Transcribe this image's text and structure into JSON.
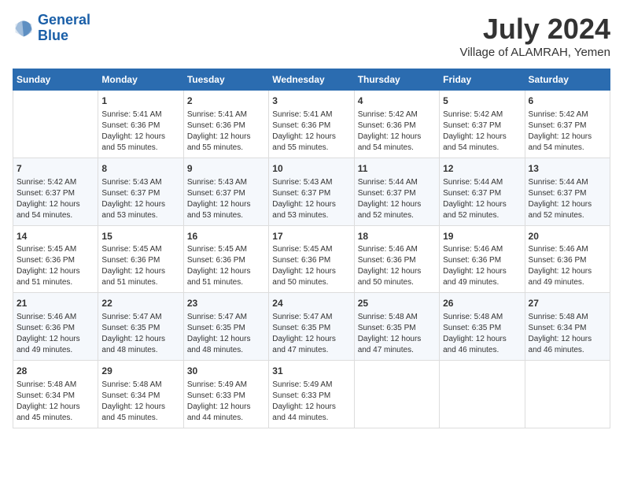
{
  "header": {
    "logo_line1": "General",
    "logo_line2": "Blue",
    "month_year": "July 2024",
    "location": "Village of ALAMRAH, Yemen"
  },
  "weekdays": [
    "Sunday",
    "Monday",
    "Tuesday",
    "Wednesday",
    "Thursday",
    "Friday",
    "Saturday"
  ],
  "weeks": [
    [
      {
        "day": "",
        "content": ""
      },
      {
        "day": "1",
        "content": "Sunrise: 5:41 AM\nSunset: 6:36 PM\nDaylight: 12 hours\nand 55 minutes."
      },
      {
        "day": "2",
        "content": "Sunrise: 5:41 AM\nSunset: 6:36 PM\nDaylight: 12 hours\nand 55 minutes."
      },
      {
        "day": "3",
        "content": "Sunrise: 5:41 AM\nSunset: 6:36 PM\nDaylight: 12 hours\nand 55 minutes."
      },
      {
        "day": "4",
        "content": "Sunrise: 5:42 AM\nSunset: 6:36 PM\nDaylight: 12 hours\nand 54 minutes."
      },
      {
        "day": "5",
        "content": "Sunrise: 5:42 AM\nSunset: 6:37 PM\nDaylight: 12 hours\nand 54 minutes."
      },
      {
        "day": "6",
        "content": "Sunrise: 5:42 AM\nSunset: 6:37 PM\nDaylight: 12 hours\nand 54 minutes."
      }
    ],
    [
      {
        "day": "7",
        "content": "Sunrise: 5:42 AM\nSunset: 6:37 PM\nDaylight: 12 hours\nand 54 minutes."
      },
      {
        "day": "8",
        "content": "Sunrise: 5:43 AM\nSunset: 6:37 PM\nDaylight: 12 hours\nand 53 minutes."
      },
      {
        "day": "9",
        "content": "Sunrise: 5:43 AM\nSunset: 6:37 PM\nDaylight: 12 hours\nand 53 minutes."
      },
      {
        "day": "10",
        "content": "Sunrise: 5:43 AM\nSunset: 6:37 PM\nDaylight: 12 hours\nand 53 minutes."
      },
      {
        "day": "11",
        "content": "Sunrise: 5:44 AM\nSunset: 6:37 PM\nDaylight: 12 hours\nand 52 minutes."
      },
      {
        "day": "12",
        "content": "Sunrise: 5:44 AM\nSunset: 6:37 PM\nDaylight: 12 hours\nand 52 minutes."
      },
      {
        "day": "13",
        "content": "Sunrise: 5:44 AM\nSunset: 6:37 PM\nDaylight: 12 hours\nand 52 minutes."
      }
    ],
    [
      {
        "day": "14",
        "content": "Sunrise: 5:45 AM\nSunset: 6:36 PM\nDaylight: 12 hours\nand 51 minutes."
      },
      {
        "day": "15",
        "content": "Sunrise: 5:45 AM\nSunset: 6:36 PM\nDaylight: 12 hours\nand 51 minutes."
      },
      {
        "day": "16",
        "content": "Sunrise: 5:45 AM\nSunset: 6:36 PM\nDaylight: 12 hours\nand 51 minutes."
      },
      {
        "day": "17",
        "content": "Sunrise: 5:45 AM\nSunset: 6:36 PM\nDaylight: 12 hours\nand 50 minutes."
      },
      {
        "day": "18",
        "content": "Sunrise: 5:46 AM\nSunset: 6:36 PM\nDaylight: 12 hours\nand 50 minutes."
      },
      {
        "day": "19",
        "content": "Sunrise: 5:46 AM\nSunset: 6:36 PM\nDaylight: 12 hours\nand 49 minutes."
      },
      {
        "day": "20",
        "content": "Sunrise: 5:46 AM\nSunset: 6:36 PM\nDaylight: 12 hours\nand 49 minutes."
      }
    ],
    [
      {
        "day": "21",
        "content": "Sunrise: 5:46 AM\nSunset: 6:36 PM\nDaylight: 12 hours\nand 49 minutes."
      },
      {
        "day": "22",
        "content": "Sunrise: 5:47 AM\nSunset: 6:35 PM\nDaylight: 12 hours\nand 48 minutes."
      },
      {
        "day": "23",
        "content": "Sunrise: 5:47 AM\nSunset: 6:35 PM\nDaylight: 12 hours\nand 48 minutes."
      },
      {
        "day": "24",
        "content": "Sunrise: 5:47 AM\nSunset: 6:35 PM\nDaylight: 12 hours\nand 47 minutes."
      },
      {
        "day": "25",
        "content": "Sunrise: 5:48 AM\nSunset: 6:35 PM\nDaylight: 12 hours\nand 47 minutes."
      },
      {
        "day": "26",
        "content": "Sunrise: 5:48 AM\nSunset: 6:35 PM\nDaylight: 12 hours\nand 46 minutes."
      },
      {
        "day": "27",
        "content": "Sunrise: 5:48 AM\nSunset: 6:34 PM\nDaylight: 12 hours\nand 46 minutes."
      }
    ],
    [
      {
        "day": "28",
        "content": "Sunrise: 5:48 AM\nSunset: 6:34 PM\nDaylight: 12 hours\nand 45 minutes."
      },
      {
        "day": "29",
        "content": "Sunrise: 5:48 AM\nSunset: 6:34 PM\nDaylight: 12 hours\nand 45 minutes."
      },
      {
        "day": "30",
        "content": "Sunrise: 5:49 AM\nSunset: 6:33 PM\nDaylight: 12 hours\nand 44 minutes."
      },
      {
        "day": "31",
        "content": "Sunrise: 5:49 AM\nSunset: 6:33 PM\nDaylight: 12 hours\nand 44 minutes."
      },
      {
        "day": "",
        "content": ""
      },
      {
        "day": "",
        "content": ""
      },
      {
        "day": "",
        "content": ""
      }
    ]
  ]
}
